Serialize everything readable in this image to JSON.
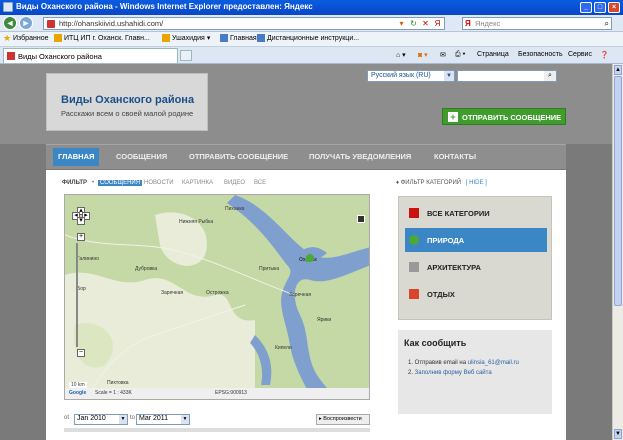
{
  "browser": {
    "title": "Виды Оханского района - Windows Internet Explorer предоставлен: Яндекс",
    "url": "http://ohanskiivid.ushahidi.com/",
    "search_placeholder": "Яндекс",
    "favorites": [
      "Избранное",
      "ИТЦ ИП г. Оханск. Главн...",
      "Ушахидия",
      "Главная",
      "Дистанционные инструкци..."
    ],
    "tab_title": "Виды Оханского района",
    "commands": [
      "Страница",
      "Безопасность",
      "Сервис"
    ]
  },
  "site": {
    "title": "Виды Оханского района",
    "tagline": "Расскажи всем о своей малой родине",
    "language": "Русский язык (RU)",
    "send_button": "ОТПРАВИТЬ СООБЩЕНИЕ",
    "menu": [
      "ГЛАВНАЯ",
      "СООБЩЕНИЯ",
      "ОТПРАВИТЬ СООБЩЕНИЕ",
      "ПОЛУЧАТЬ УВЕДОМЛЕНИЯ",
      "КОНТАКТЫ"
    ]
  },
  "filter": {
    "label": "ФИЛЬТР",
    "options": [
      "СООБЩЕНИЯ",
      "НОВОСТИ",
      "КАРТИНКА",
      "ВИДЕО",
      "ВСЕ"
    ]
  },
  "map": {
    "places": [
      "Пиханка",
      "Нижняя Рыбка",
      "Оханск",
      "Дубровка",
      "Притыка",
      "Заречная",
      "Острожка",
      "Заречная",
      "Галинино",
      "Бор",
      "Ярики",
      "Пихтовка",
      "Кипели"
    ],
    "scale_text": "Scale = 1 : 433K",
    "coords": "EPSG:900913",
    "scale_bar": "10 km"
  },
  "timeline": {
    "from_label": "ot",
    "from": "Jan 2010",
    "to_label": "to",
    "to": "Mar 2011",
    "play": "Воспроизвести"
  },
  "categories": {
    "header": "ФИЛЬТР КАТЕГОРИЙ",
    "hide": "[ HIDE ]",
    "items": [
      {
        "label": "ВСЕ КАТЕГОРИИ",
        "icon": "red-square-icon",
        "color": "#cc1111"
      },
      {
        "label": "ПРИРОДА",
        "icon": "tree-icon",
        "color": "#4caa34"
      },
      {
        "label": "АРХИТЕКТУРА",
        "icon": "building-icon",
        "color": "#999999"
      },
      {
        "label": "ОТДЫХ",
        "icon": "rest-icon",
        "color": "#d8452b"
      }
    ]
  },
  "how_to": {
    "title": "Как сообщить",
    "items": [
      {
        "prefix": "1.  Отправив email на ",
        "link": "ulinsia_61@mail.ru"
      },
      {
        "prefix": "2.  ",
        "link": "Заполнив форму Веб сайта"
      }
    ]
  },
  "colors": {
    "accent": "#3b86c4",
    "send_green": "#3f9c2d",
    "header_gray": "#8d8d8d",
    "water": "#7fa0cf",
    "land": "#c5d9a6"
  }
}
